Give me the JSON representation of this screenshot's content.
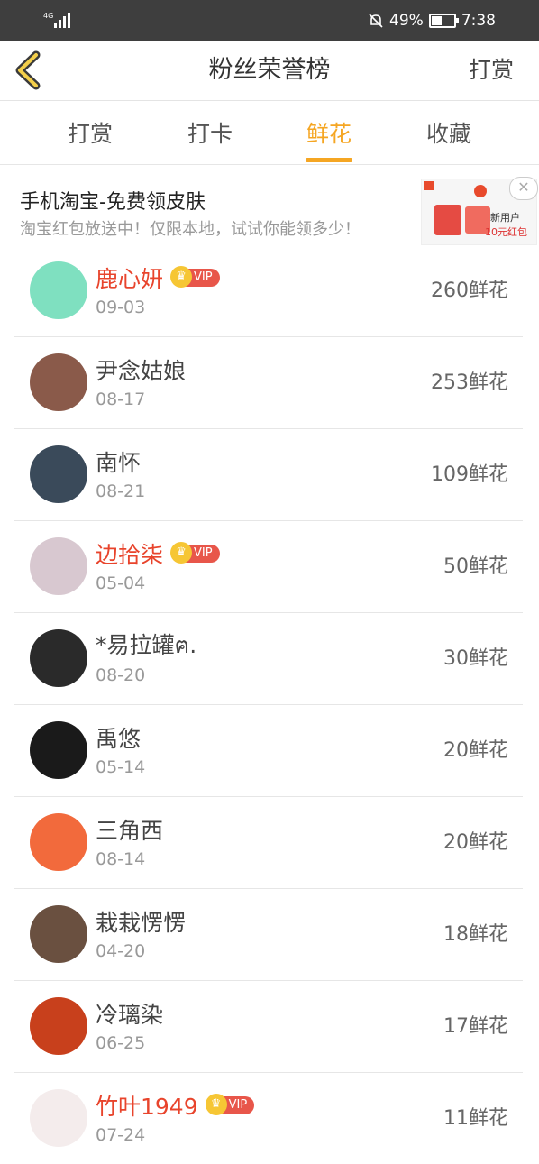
{
  "status_bar": {
    "network": "4G",
    "battery": "49%",
    "time": "7:38"
  },
  "navbar": {
    "title": "粉丝荣誉榜",
    "action": "打赏"
  },
  "tabs": [
    {
      "label": "打赏"
    },
    {
      "label": "打卡"
    },
    {
      "label": "鲜花",
      "active": true
    },
    {
      "label": "收藏"
    }
  ],
  "ad": {
    "title": "手机淘宝-免费领皮肤",
    "desc": "淘宝红包放送中！仅限本地，试试你能领多少！",
    "image_line1": "新用户",
    "image_line2": "10元红包",
    "close": "✕"
  },
  "vip_label": "VIP",
  "rows": [
    {
      "name": "鹿心妍",
      "date": "09-03",
      "count": "260鲜花",
      "vip": true,
      "avatar_color": "#7fe0c0"
    },
    {
      "name": "尹念姑娘",
      "date": "08-17",
      "count": "253鲜花",
      "vip": false,
      "avatar_color": "#8a5a4a"
    },
    {
      "name": "南怀",
      "date": "08-21",
      "count": "109鲜花",
      "vip": false,
      "avatar_color": "#3a4a5a"
    },
    {
      "name": "边拾柒",
      "date": "05-04",
      "count": "50鲜花",
      "vip": true,
      "avatar_color": "#d8c8d0"
    },
    {
      "name": "*易拉罐ฅ.",
      "date": "08-20",
      "count": "30鲜花",
      "vip": false,
      "avatar_color": "#2a2a2a"
    },
    {
      "name": "禹悠",
      "date": "05-14",
      "count": "20鲜花",
      "vip": false,
      "avatar_color": "#1a1a1a"
    },
    {
      "name": "三角西",
      "date": "08-14",
      "count": "20鲜花",
      "vip": false,
      "avatar_color": "#f26a3c"
    },
    {
      "name": "栽栽愣愣",
      "date": "04-20",
      "count": "18鲜花",
      "vip": false,
      "avatar_color": "#6a5040"
    },
    {
      "name": "冷璃染",
      "date": "06-25",
      "count": "17鲜花",
      "vip": false,
      "avatar_color": "#c8401c"
    },
    {
      "name": "竹叶1949",
      "date": "07-24",
      "count": "11鲜花",
      "vip": true,
      "avatar_color": "#f4ecec"
    }
  ]
}
